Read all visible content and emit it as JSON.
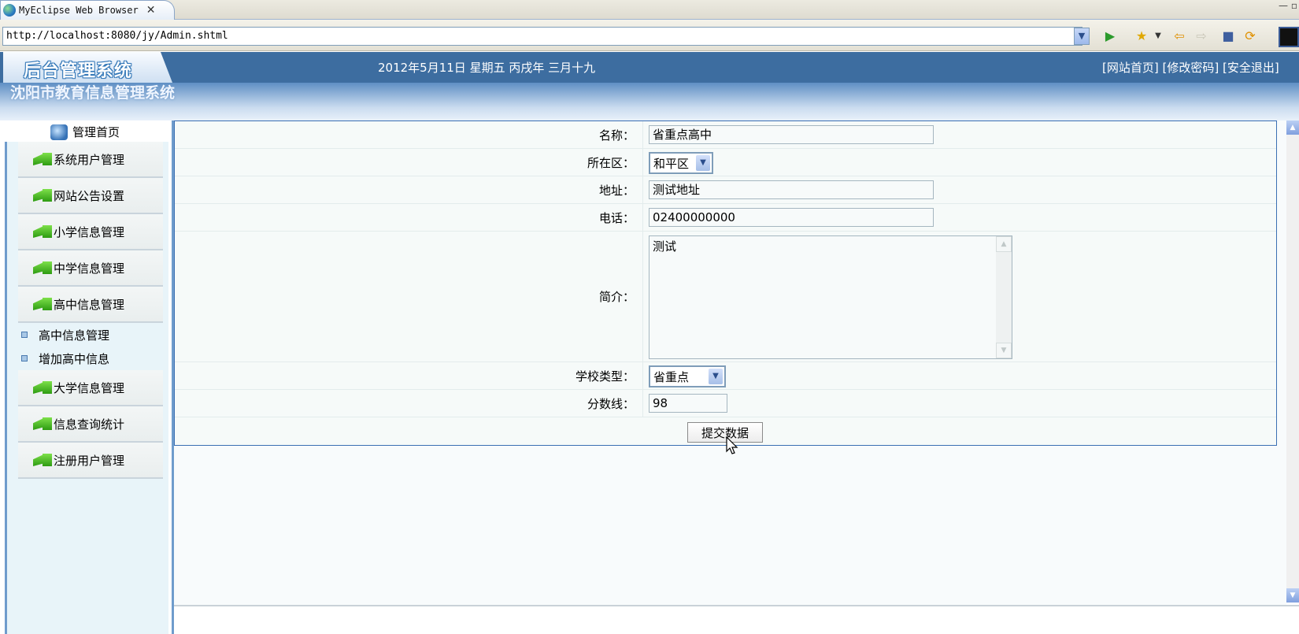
{
  "browser": {
    "tab_title": "MyEclipse Web Browser",
    "close_glyph": "✕",
    "window_controls": "— ▫",
    "url": "http://localhost:8080/jy/Admin.shtml"
  },
  "header": {
    "logo": "后台管理系统",
    "date": "2012年5月11日 星期五 丙戌年 三月十九",
    "links": [
      "[网站首页]",
      "[修改密码]",
      "[安全退出]"
    ]
  },
  "sidebar": {
    "system_title": "沈阳市教育信息管理系统",
    "home": "管理首页",
    "menu": [
      "系统用户管理",
      "网站公告设置",
      "小学信息管理",
      "中学信息管理",
      "高中信息管理"
    ],
    "submenu": [
      "高中信息管理",
      "增加高中信息"
    ],
    "menu_after": [
      "大学信息管理",
      "信息查询统计",
      "注册用户管理"
    ]
  },
  "form": {
    "name_label": "名称：",
    "name_value": "省重点高中",
    "district_label": "所在区：",
    "district_value": "和平区",
    "address_label": "地址：",
    "address_value": "测试地址",
    "phone_label": "电话：",
    "phone_value": "02400000000",
    "intro_label": "简介：",
    "intro_value": "测试",
    "type_label": "学校类型：",
    "type_value": "省重点",
    "score_label": "分数线：",
    "score_value": "98",
    "submit_label": "提交数据"
  },
  "colors": {
    "banner": "#3d6da0",
    "frame_border": "#3b6fb3",
    "menu_bg": "#e8f4f9"
  }
}
